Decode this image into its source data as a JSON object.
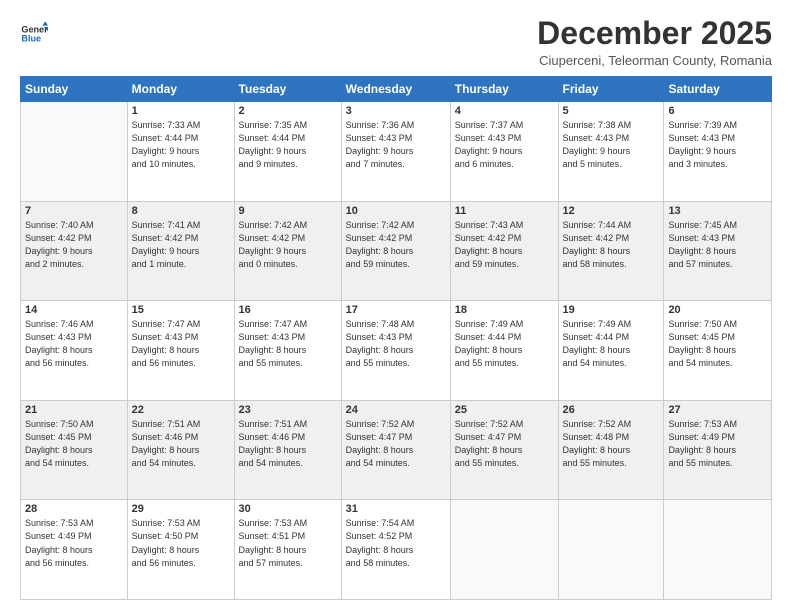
{
  "header": {
    "logo_line1": "General",
    "logo_line2": "Blue",
    "title": "December 2025",
    "subtitle": "Ciuperceni, Teleorman County, Romania"
  },
  "days_of_week": [
    "Sunday",
    "Monday",
    "Tuesday",
    "Wednesday",
    "Thursday",
    "Friday",
    "Saturday"
  ],
  "weeks": [
    [
      {
        "day": "",
        "info": ""
      },
      {
        "day": "1",
        "info": "Sunrise: 7:33 AM\nSunset: 4:44 PM\nDaylight: 9 hours\nand 10 minutes."
      },
      {
        "day": "2",
        "info": "Sunrise: 7:35 AM\nSunset: 4:44 PM\nDaylight: 9 hours\nand 9 minutes."
      },
      {
        "day": "3",
        "info": "Sunrise: 7:36 AM\nSunset: 4:43 PM\nDaylight: 9 hours\nand 7 minutes."
      },
      {
        "day": "4",
        "info": "Sunrise: 7:37 AM\nSunset: 4:43 PM\nDaylight: 9 hours\nand 6 minutes."
      },
      {
        "day": "5",
        "info": "Sunrise: 7:38 AM\nSunset: 4:43 PM\nDaylight: 9 hours\nand 5 minutes."
      },
      {
        "day": "6",
        "info": "Sunrise: 7:39 AM\nSunset: 4:43 PM\nDaylight: 9 hours\nand 3 minutes."
      }
    ],
    [
      {
        "day": "7",
        "info": "Sunrise: 7:40 AM\nSunset: 4:42 PM\nDaylight: 9 hours\nand 2 minutes."
      },
      {
        "day": "8",
        "info": "Sunrise: 7:41 AM\nSunset: 4:42 PM\nDaylight: 9 hours\nand 1 minute."
      },
      {
        "day": "9",
        "info": "Sunrise: 7:42 AM\nSunset: 4:42 PM\nDaylight: 9 hours\nand 0 minutes."
      },
      {
        "day": "10",
        "info": "Sunrise: 7:42 AM\nSunset: 4:42 PM\nDaylight: 8 hours\nand 59 minutes."
      },
      {
        "day": "11",
        "info": "Sunrise: 7:43 AM\nSunset: 4:42 PM\nDaylight: 8 hours\nand 59 minutes."
      },
      {
        "day": "12",
        "info": "Sunrise: 7:44 AM\nSunset: 4:42 PM\nDaylight: 8 hours\nand 58 minutes."
      },
      {
        "day": "13",
        "info": "Sunrise: 7:45 AM\nSunset: 4:43 PM\nDaylight: 8 hours\nand 57 minutes."
      }
    ],
    [
      {
        "day": "14",
        "info": "Sunrise: 7:46 AM\nSunset: 4:43 PM\nDaylight: 8 hours\nand 56 minutes."
      },
      {
        "day": "15",
        "info": "Sunrise: 7:47 AM\nSunset: 4:43 PM\nDaylight: 8 hours\nand 56 minutes."
      },
      {
        "day": "16",
        "info": "Sunrise: 7:47 AM\nSunset: 4:43 PM\nDaylight: 8 hours\nand 55 minutes."
      },
      {
        "day": "17",
        "info": "Sunrise: 7:48 AM\nSunset: 4:43 PM\nDaylight: 8 hours\nand 55 minutes."
      },
      {
        "day": "18",
        "info": "Sunrise: 7:49 AM\nSunset: 4:44 PM\nDaylight: 8 hours\nand 55 minutes."
      },
      {
        "day": "19",
        "info": "Sunrise: 7:49 AM\nSunset: 4:44 PM\nDaylight: 8 hours\nand 54 minutes."
      },
      {
        "day": "20",
        "info": "Sunrise: 7:50 AM\nSunset: 4:45 PM\nDaylight: 8 hours\nand 54 minutes."
      }
    ],
    [
      {
        "day": "21",
        "info": "Sunrise: 7:50 AM\nSunset: 4:45 PM\nDaylight: 8 hours\nand 54 minutes."
      },
      {
        "day": "22",
        "info": "Sunrise: 7:51 AM\nSunset: 4:46 PM\nDaylight: 8 hours\nand 54 minutes."
      },
      {
        "day": "23",
        "info": "Sunrise: 7:51 AM\nSunset: 4:46 PM\nDaylight: 8 hours\nand 54 minutes."
      },
      {
        "day": "24",
        "info": "Sunrise: 7:52 AM\nSunset: 4:47 PM\nDaylight: 8 hours\nand 54 minutes."
      },
      {
        "day": "25",
        "info": "Sunrise: 7:52 AM\nSunset: 4:47 PM\nDaylight: 8 hours\nand 55 minutes."
      },
      {
        "day": "26",
        "info": "Sunrise: 7:52 AM\nSunset: 4:48 PM\nDaylight: 8 hours\nand 55 minutes."
      },
      {
        "day": "27",
        "info": "Sunrise: 7:53 AM\nSunset: 4:49 PM\nDaylight: 8 hours\nand 55 minutes."
      }
    ],
    [
      {
        "day": "28",
        "info": "Sunrise: 7:53 AM\nSunset: 4:49 PM\nDaylight: 8 hours\nand 56 minutes."
      },
      {
        "day": "29",
        "info": "Sunrise: 7:53 AM\nSunset: 4:50 PM\nDaylight: 8 hours\nand 56 minutes."
      },
      {
        "day": "30",
        "info": "Sunrise: 7:53 AM\nSunset: 4:51 PM\nDaylight: 8 hours\nand 57 minutes."
      },
      {
        "day": "31",
        "info": "Sunrise: 7:54 AM\nSunset: 4:52 PM\nDaylight: 8 hours\nand 58 minutes."
      },
      {
        "day": "",
        "info": ""
      },
      {
        "day": "",
        "info": ""
      },
      {
        "day": "",
        "info": ""
      }
    ]
  ]
}
